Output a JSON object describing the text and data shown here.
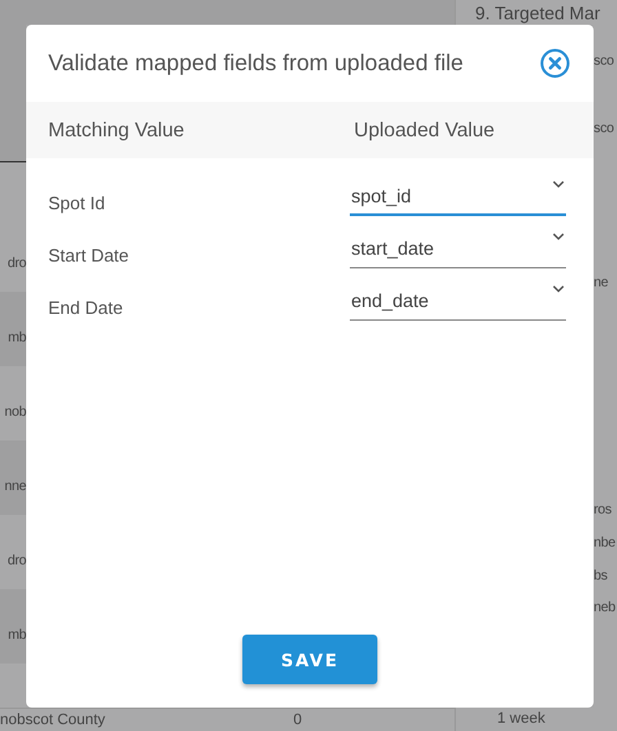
{
  "background": {
    "top_right_heading": "9. Targeted Mar",
    "left_fragments": [
      "dro",
      "mb",
      "nob",
      "nne",
      "dro",
      "mb"
    ],
    "right_fragments": [
      "sco",
      "sco",
      "ne",
      "ros",
      "nbe",
      "bs",
      "neb"
    ],
    "bottom_row": {
      "name": "nobscot County",
      "count": "0",
      "duration": "1 week"
    }
  },
  "dialog": {
    "title": "Validate mapped fields from uploaded file",
    "columns": [
      "Matching Value",
      "Uploaded Value"
    ],
    "fields": [
      {
        "label": "Spot Id",
        "value": "spot_id",
        "focused": true
      },
      {
        "label": "Start Date",
        "value": "start_date",
        "focused": false
      },
      {
        "label": "End Date",
        "value": "end_date",
        "focused": false
      }
    ],
    "save_button": "SAVE"
  }
}
